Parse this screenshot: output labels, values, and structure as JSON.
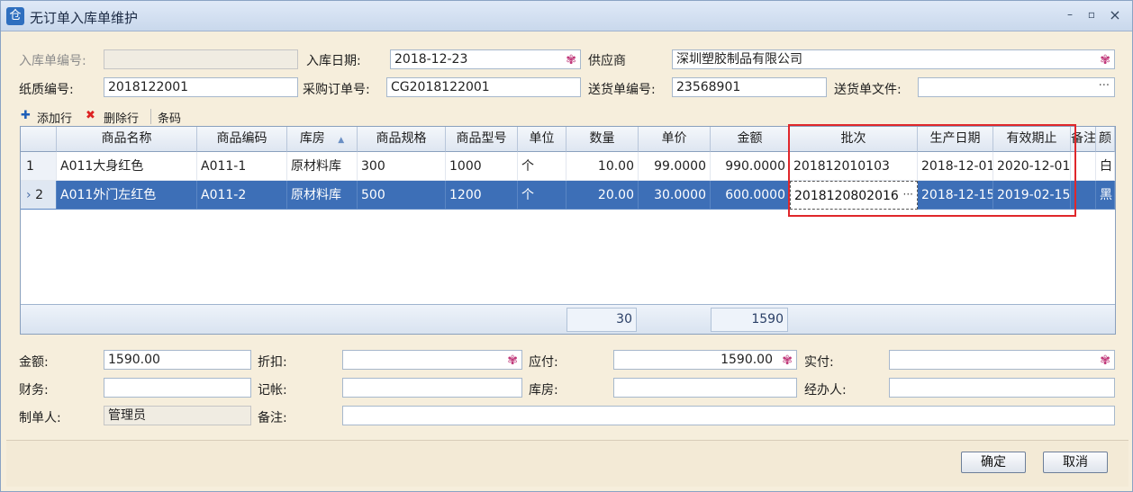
{
  "window": {
    "title": "无订单入库单维护",
    "app_icon": "仓",
    "minimize": "–",
    "maximize": "▫",
    "close": "×"
  },
  "header": {
    "receipt_no_label": "入库单编号:",
    "receipt_no_value": "",
    "date_label": "入库日期:",
    "date_value": "2018-12-23",
    "supplier_label": "供应商",
    "supplier_value": "深圳塑胶制品有限公司",
    "paper_no_label": "纸质编号:",
    "paper_no_value": "2018122001",
    "po_label": "采购订单号:",
    "po_value": "CG2018122001",
    "delivery_no_label": "送货单编号:",
    "delivery_no_value": "23568901",
    "delivery_file_label": "送货单文件:",
    "delivery_file_value": "",
    "dots": "···"
  },
  "toolbar": {
    "add_label": "添加行",
    "delete_label": "删除行",
    "barcode_label": "条码"
  },
  "grid": {
    "columns": [
      "商品名称",
      "商品编码",
      "库房",
      "商品规格",
      "商品型号",
      "单位",
      "数量",
      "单价",
      "金额",
      "批次",
      "生产日期",
      "有效期止",
      "备注",
      "颜"
    ],
    "sort_indicator": "▲",
    "rows": [
      {
        "idx": "1",
        "name": "A011大身红色",
        "code": "A011-1",
        "warehouse": "原材料库",
        "spec": "300",
        "model": "1000",
        "unit": "个",
        "qty": "10.00",
        "price": "99.0000",
        "amount": "990.0000",
        "batch": "201812010103",
        "prod_date": "2018-12-01",
        "expiry": "2020-12-01",
        "note": "",
        "color": "白"
      },
      {
        "idx": "2",
        "name": "A011外门左红色",
        "code": "A011-2",
        "warehouse": "原材料库",
        "spec": "500",
        "model": "1200",
        "unit": "个",
        "qty": "20.00",
        "price": "30.0000",
        "amount": "600.0000",
        "batch": "2018120802016",
        "prod_date": "2018-12-15",
        "expiry": "2019-02-15",
        "note": "",
        "color": "黑"
      }
    ],
    "totals": {
      "qty": "30",
      "amount": "1590"
    },
    "row_indicator": "›",
    "batch_dots": "···"
  },
  "summary": {
    "amount_label": "金额:",
    "amount_value": "1590.00",
    "discount_label": "折扣:",
    "discount_value": "",
    "payable_label": "应付:",
    "payable_value": "1590.00",
    "paid_label": "实付:",
    "paid_value": "",
    "finance_label": "财务:",
    "finance_value": "",
    "bookkeep_label": "记帐:",
    "bookkeep_value": "",
    "warehouse_label": "库房:",
    "warehouse_value": "",
    "handler_label": "经办人:",
    "handler_value": "",
    "creator_label": "制单人:",
    "creator_value": "管理员",
    "remark_label": "备注:",
    "remark_value": ""
  },
  "buttons": {
    "ok": "确定",
    "cancel": "取消"
  },
  "icons": {
    "picker": "picker-icon",
    "add": "plus-icon",
    "delete": "delete-x-icon"
  },
  "colors": {
    "selection": "#3d6fb7",
    "highlight_border": "#e0272b",
    "background": "#f6eedc"
  }
}
